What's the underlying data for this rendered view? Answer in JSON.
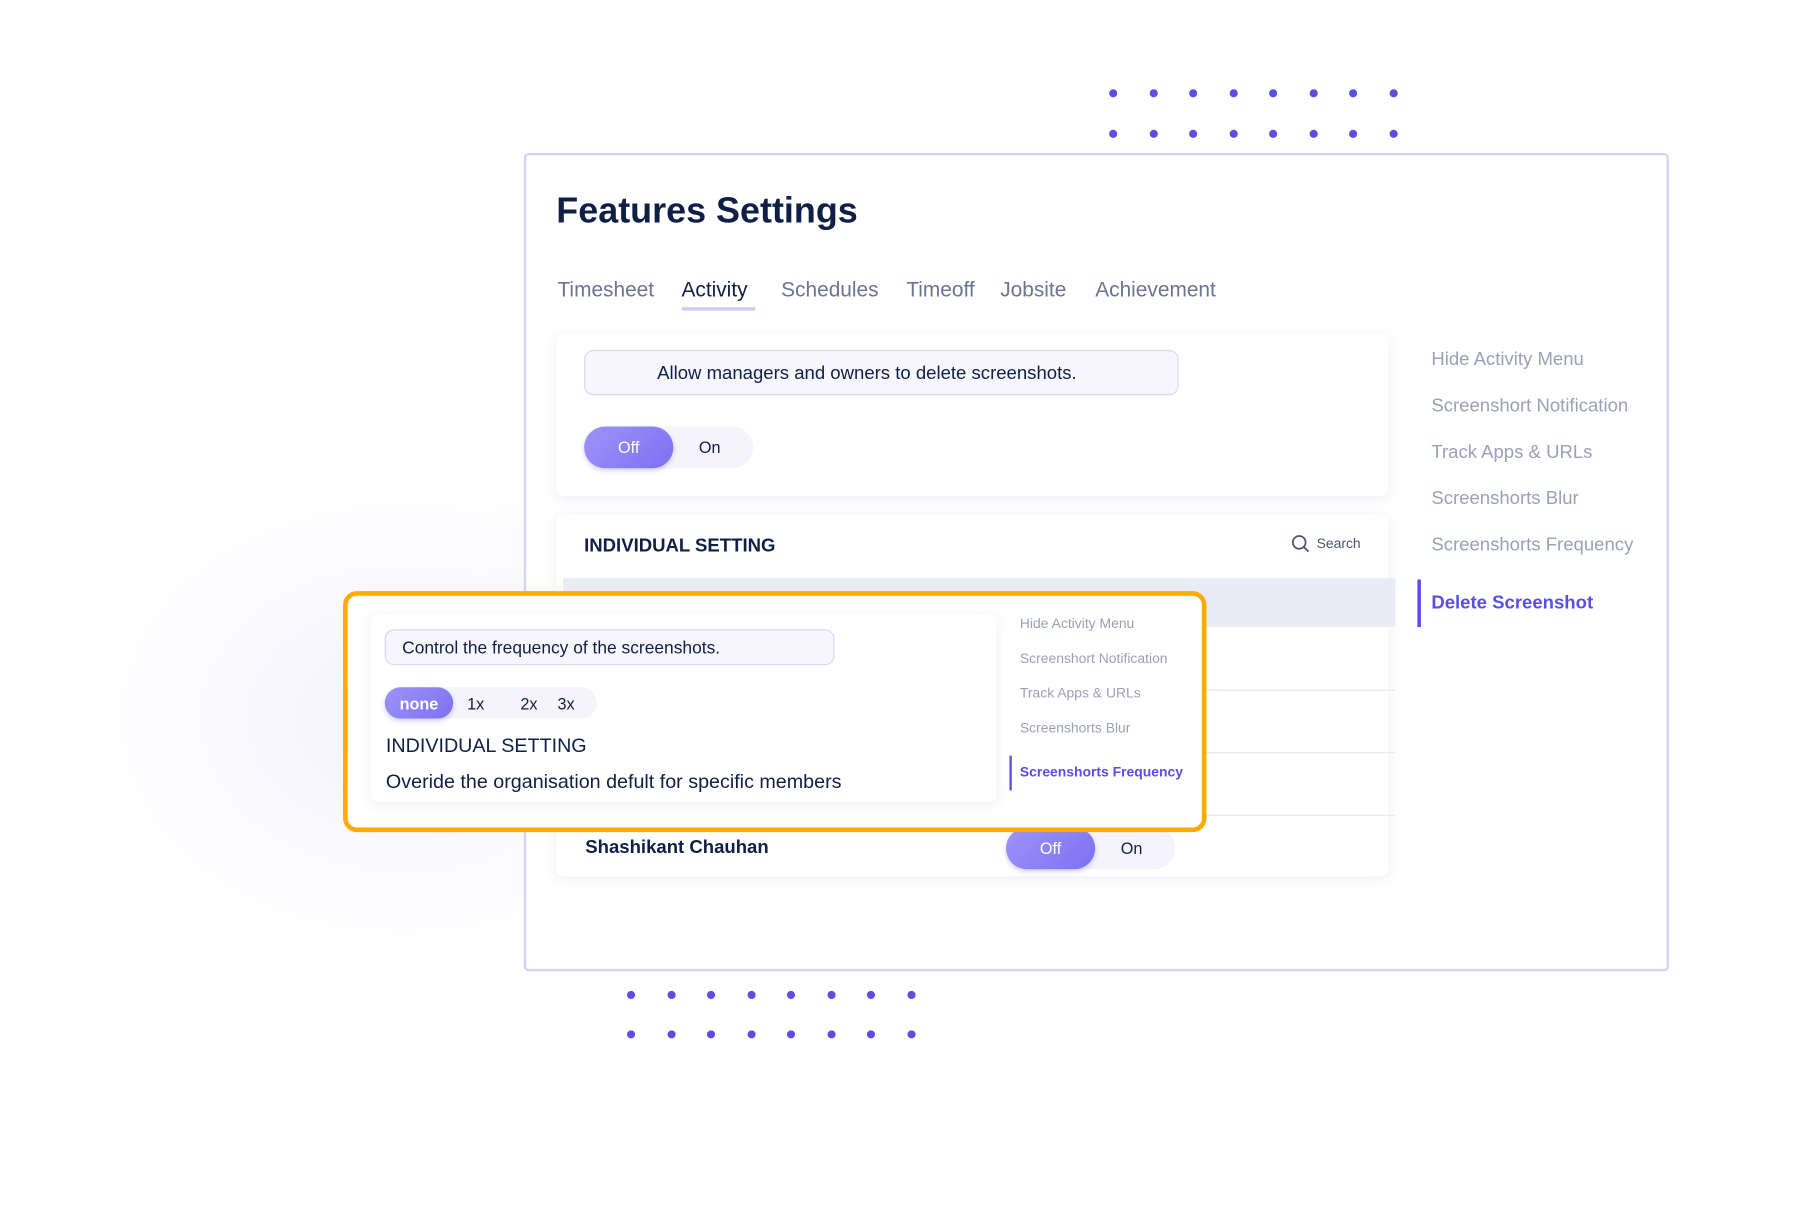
{
  "colors": {
    "accent": "#7d70f2",
    "highlight_border": "#ffaa00",
    "title": "#0f1f45",
    "nav_active": "#5b4fe0"
  },
  "title": "Features Settings",
  "tabs": [
    {
      "label": "Timesheet"
    },
    {
      "label": "Activity",
      "active": true
    },
    {
      "label": "Schedules"
    },
    {
      "label": "Timeoff"
    },
    {
      "label": "Jobsite"
    },
    {
      "label": "Achievement"
    }
  ],
  "setting": {
    "description": "Allow managers and owners to delete screenshots.",
    "toggle": {
      "off": "Off",
      "on": "On",
      "selected": "Off"
    }
  },
  "individual": {
    "heading": "INDIVIDUAL SETTING",
    "search_label": "Search",
    "search_icon": "search-icon",
    "member": {
      "name": "Shashikant Chauhan",
      "toggle": {
        "off": "Off",
        "on": "On",
        "selected": "Off"
      }
    }
  },
  "side_nav": {
    "items": [
      {
        "label": "Hide Activity Menu"
      },
      {
        "label": "Screenshort Notification"
      },
      {
        "label": "Track Apps & URLs"
      },
      {
        "label": "Screenshorts Blur"
      },
      {
        "label": "Screenshorts Frequency"
      },
      {
        "label": "Delete Screenshot",
        "active": true
      }
    ]
  },
  "overlay": {
    "description": "Control the frequency of the screenshots.",
    "options": [
      "none",
      "1x",
      "2x",
      "3x"
    ],
    "selected": "none",
    "heading": "INDIVIDUAL SETTING",
    "subtext": "Overide the organisation defult for specific members",
    "nav": [
      {
        "label": "Hide Activity Menu"
      },
      {
        "label": "Screenshort Notification"
      },
      {
        "label": "Track Apps & URLs"
      },
      {
        "label": "Screenshorts Blur"
      },
      {
        "label": "Screenshorts Frequency",
        "active": true
      }
    ]
  }
}
